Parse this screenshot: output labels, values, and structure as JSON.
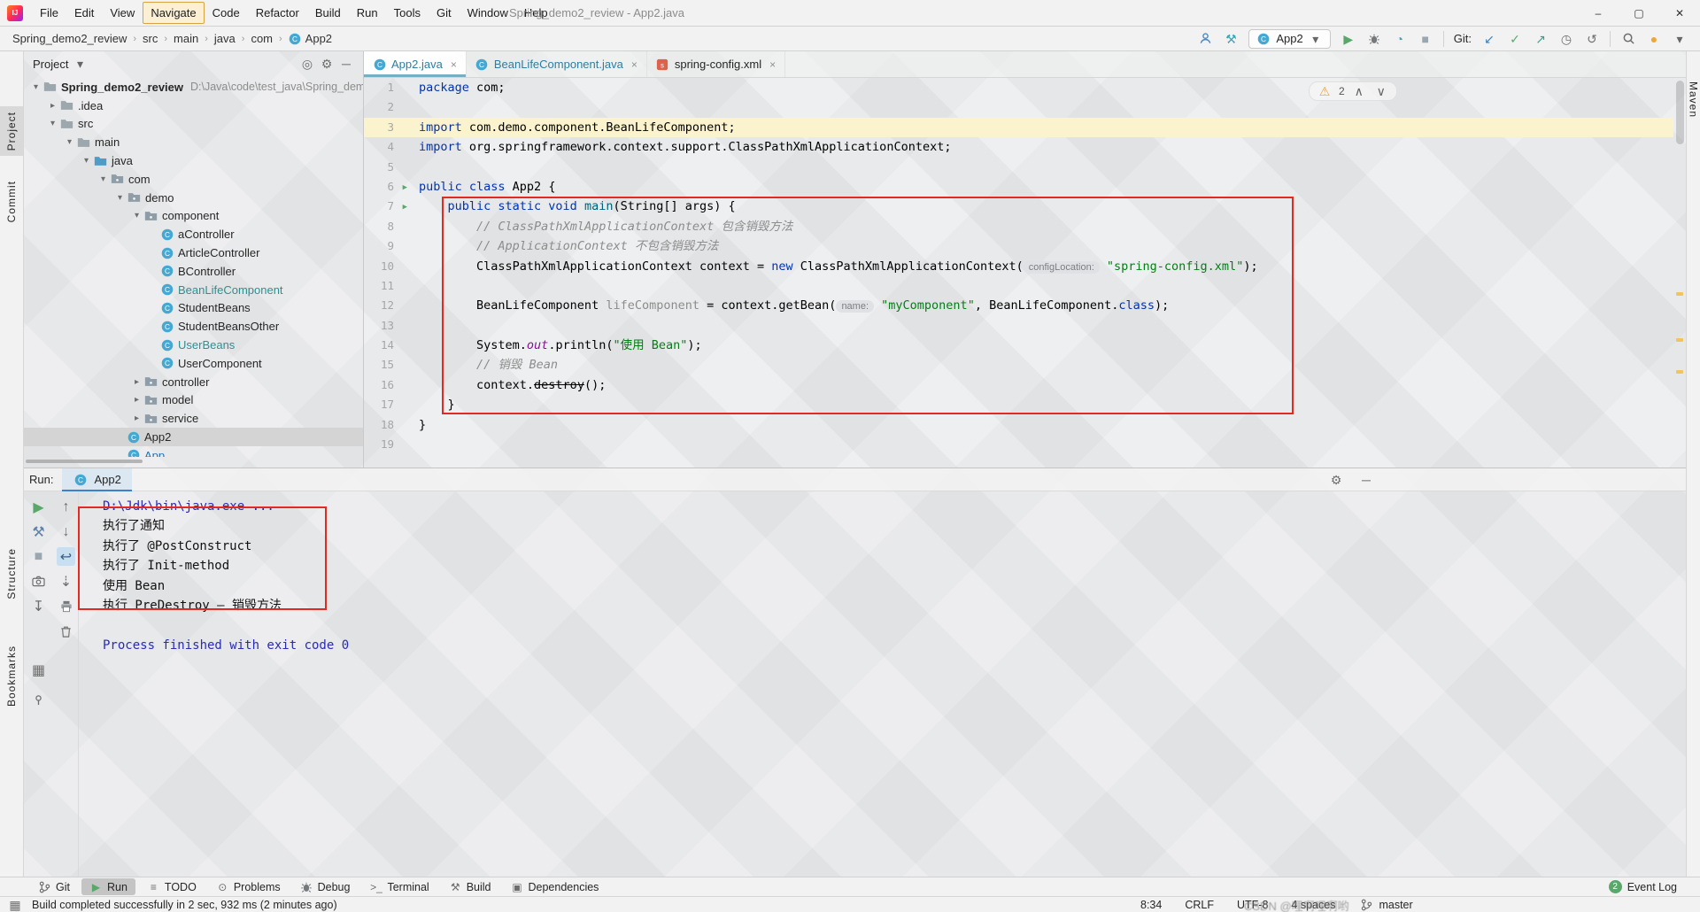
{
  "colors": {
    "accent_teal": "#3592C4",
    "run_green": "#59A869",
    "annotation_red": "#E02A22",
    "warning_yellow": "#E8A33D",
    "keyword_blue": "#0033B3",
    "string_green": "#067D17",
    "comment_gray": "#8C8C8C"
  },
  "window": {
    "title": "Spring_demo2_review - App2.java"
  },
  "menu": {
    "items": [
      "File",
      "Edit",
      "View",
      "Navigate",
      "Code",
      "Refactor",
      "Build",
      "Run",
      "Tools",
      "Git",
      "Window",
      "Help"
    ],
    "highlighted": "Navigate"
  },
  "navbar": {
    "breadcrumbs": [
      "Spring_demo2_review",
      "src",
      "main",
      "java",
      "com",
      "App2"
    ],
    "run_config": "App2",
    "git_label": "Git:"
  },
  "left_stripe": {
    "top": [
      "Project",
      "Commit"
    ],
    "bottom": [
      "Structure",
      "Bookmarks"
    ]
  },
  "right_stripe": {
    "top": [
      "Maven"
    ]
  },
  "project_panel": {
    "title": "Project",
    "tree": [
      {
        "depth": 0,
        "chevron": "open",
        "icon": "folder",
        "label": "Spring_demo2_review",
        "bold": true,
        "suffix": "D:\\Java\\code\\test_java\\Spring_dem"
      },
      {
        "depth": 1,
        "chevron": "closed",
        "icon": "folder",
        "label": ".idea"
      },
      {
        "depth": 1,
        "chevron": "open",
        "icon": "folder",
        "label": "src"
      },
      {
        "depth": 2,
        "chevron": "open",
        "icon": "folder",
        "label": "main"
      },
      {
        "depth": 3,
        "chevron": "open",
        "icon": "folder-src",
        "label": "java"
      },
      {
        "depth": 4,
        "chevron": "open",
        "icon": "package",
        "label": "com"
      },
      {
        "depth": 5,
        "chevron": "open",
        "icon": "package",
        "label": "demo"
      },
      {
        "depth": 6,
        "chevron": "open",
        "icon": "package",
        "label": "component"
      },
      {
        "depth": 7,
        "icon": "class",
        "label": "aController"
      },
      {
        "depth": 7,
        "icon": "class",
        "label": "ArticleController"
      },
      {
        "depth": 7,
        "icon": "class",
        "label": "BController"
      },
      {
        "depth": 7,
        "icon": "class",
        "label": "BeanLifeComponent",
        "color": "teal"
      },
      {
        "depth": 7,
        "icon": "class",
        "label": "StudentBeans"
      },
      {
        "depth": 7,
        "icon": "class",
        "label": "StudentBeansOther"
      },
      {
        "depth": 7,
        "icon": "class",
        "label": "UserBeans",
        "color": "teal"
      },
      {
        "depth": 7,
        "icon": "class",
        "label": "UserComponent"
      },
      {
        "depth": 6,
        "chevron": "closed",
        "icon": "package",
        "label": "controller"
      },
      {
        "depth": 6,
        "chevron": "closed",
        "icon": "package",
        "label": "model"
      },
      {
        "depth": 6,
        "chevron": "closed",
        "icon": "package",
        "label": "service"
      },
      {
        "depth": 5,
        "icon": "class",
        "label": "App2",
        "selected": true
      },
      {
        "depth": 5,
        "icon": "class",
        "label": "App",
        "color": "blue"
      }
    ]
  },
  "editor": {
    "tabs": [
      {
        "label": "App2.java",
        "icon": "class",
        "color": "teal",
        "active": true
      },
      {
        "label": "BeanLifeComponent.java",
        "icon": "class",
        "color": "teal"
      },
      {
        "label": "spring-config.xml",
        "icon": "spring",
        "color": "dark"
      }
    ],
    "inspection": {
      "warnings": "2"
    },
    "code": [
      {
        "n": 1,
        "seg": [
          [
            "k",
            "package"
          ],
          [
            "p",
            " com;"
          ]
        ]
      },
      {
        "n": 2,
        "seg": []
      },
      {
        "n": 3,
        "hl": true,
        "seg": [
          [
            "k",
            "import"
          ],
          [
            "p",
            " com.demo.component.BeanLifeComponent;"
          ]
        ]
      },
      {
        "n": 4,
        "seg": [
          [
            "k",
            "import"
          ],
          [
            "p",
            " org.springframework.context.support.ClassPathXmlApplicationContext;"
          ]
        ]
      },
      {
        "n": 5,
        "seg": []
      },
      {
        "n": 6,
        "run": true,
        "seg": [
          [
            "k",
            "public class"
          ],
          [
            "p",
            " App2 {"
          ]
        ]
      },
      {
        "n": 7,
        "run": true,
        "seg": [
          [
            "p",
            "    "
          ],
          [
            "k",
            "public static void"
          ],
          [
            "p",
            " "
          ],
          [
            "m",
            "main"
          ],
          [
            "p",
            "(String[] args) {"
          ]
        ]
      },
      {
        "n": 8,
        "seg": [
          [
            "p",
            "        "
          ],
          [
            "c",
            "// ClassPathXmlApplicationContext 包含销毁方法"
          ]
        ]
      },
      {
        "n": 9,
        "seg": [
          [
            "p",
            "        "
          ],
          [
            "c",
            "// ApplicationContext 不包含销毁方法"
          ]
        ]
      },
      {
        "n": 10,
        "seg": [
          [
            "p",
            "        ClassPathXmlApplicationContext context = "
          ],
          [
            "k",
            "new"
          ],
          [
            "p",
            " ClassPathXmlApplicationContext("
          ],
          [
            "h",
            "configLocation:"
          ],
          [
            "p",
            " "
          ],
          [
            "s",
            "\"spring-config.xml\""
          ],
          [
            "p",
            ");"
          ]
        ]
      },
      {
        "n": 11,
        "seg": []
      },
      {
        "n": 12,
        "seg": [
          [
            "p",
            "        BeanLifeComponent "
          ],
          [
            "g",
            "lifeComponent"
          ],
          [
            "p",
            " = context.getBean("
          ],
          [
            "h",
            "name:"
          ],
          [
            "p",
            " "
          ],
          [
            "s",
            "\"myComponent\""
          ],
          [
            "p",
            ", BeanLifeComponent."
          ],
          [
            "k",
            "class"
          ],
          [
            "p",
            ");"
          ]
        ]
      },
      {
        "n": 13,
        "seg": []
      },
      {
        "n": 14,
        "seg": [
          [
            "p",
            "        System."
          ],
          [
            "f",
            "out"
          ],
          [
            "p",
            ".println("
          ],
          [
            "s",
            "\"使用 Bean\""
          ],
          [
            "p",
            ");"
          ]
        ]
      },
      {
        "n": 15,
        "seg": [
          [
            "p",
            "        "
          ],
          [
            "c",
            "// 销毁 Bean"
          ]
        ]
      },
      {
        "n": 16,
        "seg": [
          [
            "p",
            "        context."
          ],
          [
            "d",
            "destroy"
          ],
          [
            "p",
            "();"
          ]
        ]
      },
      {
        "n": 17,
        "seg": [
          [
            "p",
            "    }"
          ]
        ]
      },
      {
        "n": 18,
        "seg": [
          [
            "p",
            "}"
          ]
        ]
      },
      {
        "n": 19,
        "seg": []
      }
    ]
  },
  "run_panel": {
    "label": "Run:",
    "tab": "App2",
    "toolbar_col1": [
      "rerun",
      "wrench",
      "stop",
      "camera",
      "export",
      "layout",
      "pin"
    ],
    "toolbar_col2": [
      "up",
      "down",
      "soft-wrap",
      "scroll-end",
      "print",
      "clear"
    ],
    "toolbar_active": "soft-wrap",
    "console": [
      {
        "type": "sys",
        "text": "D:\\Jdk\\bin\\java.exe ..."
      },
      {
        "type": "out",
        "text": "执行了通知"
      },
      {
        "type": "out",
        "text": "执行了 @PostConstruct"
      },
      {
        "type": "out",
        "text": "执行了 Init-method"
      },
      {
        "type": "out",
        "text": "使用 Bean"
      },
      {
        "type": "out",
        "text": "执行 PreDestroy — 销毁方法"
      },
      {
        "type": "out",
        "text": ""
      },
      {
        "type": "sys",
        "text": "Process finished with exit code 0"
      }
    ]
  },
  "bottom_bar": {
    "items": [
      {
        "icon": "git-branch",
        "label": "Git"
      },
      {
        "icon": "play",
        "label": "Run",
        "active": true
      },
      {
        "icon": "todo",
        "label": "TODO"
      },
      {
        "icon": "problems",
        "label": "Problems"
      },
      {
        "icon": "bug",
        "label": "Debug"
      },
      {
        "icon": "terminal",
        "label": "Terminal"
      },
      {
        "icon": "build",
        "label": "Build"
      },
      {
        "icon": "dependencies",
        "label": "Dependencies"
      }
    ],
    "event_log": {
      "badge": "2",
      "label": "Event Log"
    }
  },
  "status_bar": {
    "message": "Build completed successfully in 2 sec, 932 ms (2 minutes ago)",
    "caret": "8:34",
    "line_sep": "CRLF",
    "encoding": "UTF-8",
    "indent": "4 spaces",
    "branch": "master",
    "watermark": "CSDN @哩啊哩啊哟"
  }
}
